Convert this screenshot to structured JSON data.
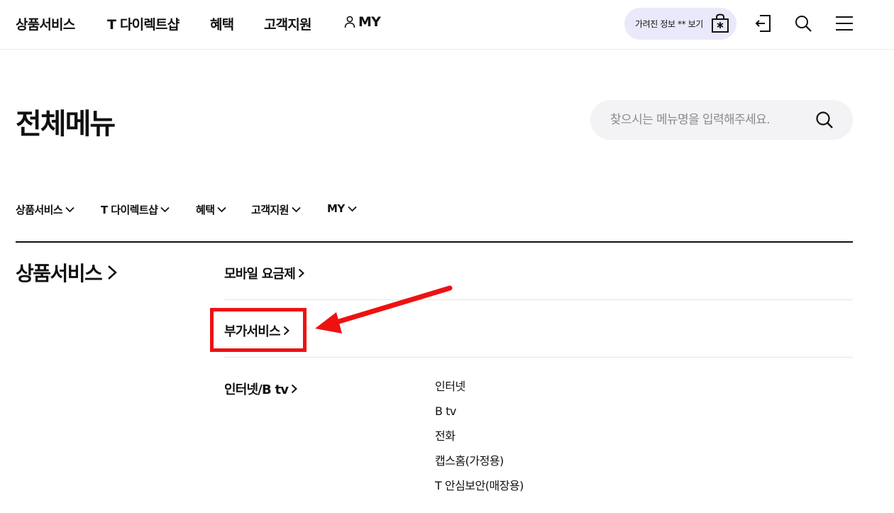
{
  "header": {
    "nav": [
      "상품서비스",
      "T 다이렉트샵",
      "혜택",
      "고객지원",
      "MY"
    ],
    "hidden_info_label": "가려진 정보 ** 보기"
  },
  "page": {
    "title": "전체메뉴",
    "search_placeholder": "찾으시는 메뉴명을 입력해주세요."
  },
  "categories": [
    "상품서비스",
    "T 다이렉트샵",
    "혜택",
    "고객지원",
    "MY"
  ],
  "section": {
    "title": "상품서비스",
    "items": [
      {
        "label": "모바일 요금제"
      },
      {
        "label": "부가서비스"
      },
      {
        "label": "인터넷/B tv"
      }
    ],
    "internet_children": [
      "인터넷",
      "B tv",
      "전화",
      "캡스홈(가정용)",
      "T 안심보안(매장용)"
    ]
  },
  "annotation": {
    "highlight_color": "#ee1111"
  },
  "colors": {
    "pill_bg": "#e9e9fb",
    "search_bg": "#f3f3f5",
    "text": "#111111"
  }
}
